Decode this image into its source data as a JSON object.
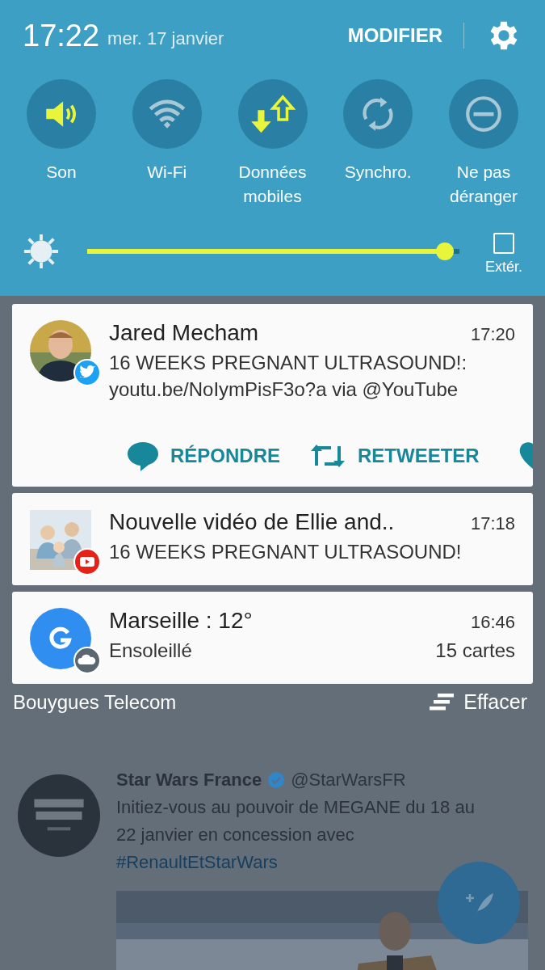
{
  "status": {
    "time": "17:22",
    "date": "mer. 17 janvier",
    "edit_label": "MODIFIER"
  },
  "toggles": [
    {
      "kind": "sound",
      "label": "Son",
      "on": true
    },
    {
      "kind": "wifi",
      "label": "Wi-Fi",
      "on": false
    },
    {
      "kind": "data",
      "label": "Données mobiles",
      "on": true
    },
    {
      "kind": "sync",
      "label": "Synchro.",
      "on": false
    },
    {
      "kind": "dnd",
      "label": "Ne pas déranger",
      "on": false
    }
  ],
  "brightness": {
    "level": 0.96,
    "outdoor_label": "Extér.",
    "outdoor_checked": false
  },
  "notifications": [
    {
      "kind": "twitter",
      "title": "Jared Mecham",
      "time": "17:20",
      "text": "16 WEEKS PREGNANT ULTRASOUND!: youtu.be/NoIymPisF3o?a via @YouTube",
      "actions": [
        "RÉPONDRE",
        "RETWEETER"
      ]
    },
    {
      "kind": "youtube",
      "title": "Nouvelle vidéo de Ellie and..",
      "time": "17:18",
      "text": "16 WEEKS PREGNANT ULTRASOUND!"
    },
    {
      "kind": "weather",
      "title": "Marseille : 12°",
      "time": "16:46",
      "text": "Ensoleillé",
      "count": "15 cartes"
    }
  ],
  "footer": {
    "carrier": "Bouygues Telecom",
    "clear_label": "Effacer"
  },
  "background_tweet": {
    "name": "Star Wars France",
    "handle": "@StarWarsFR",
    "text": "Initiez-vous au pouvoir de MEGANE du 18 au 22 janvier en concession avec",
    "hashtag": "#RenaultEtStarWars"
  }
}
